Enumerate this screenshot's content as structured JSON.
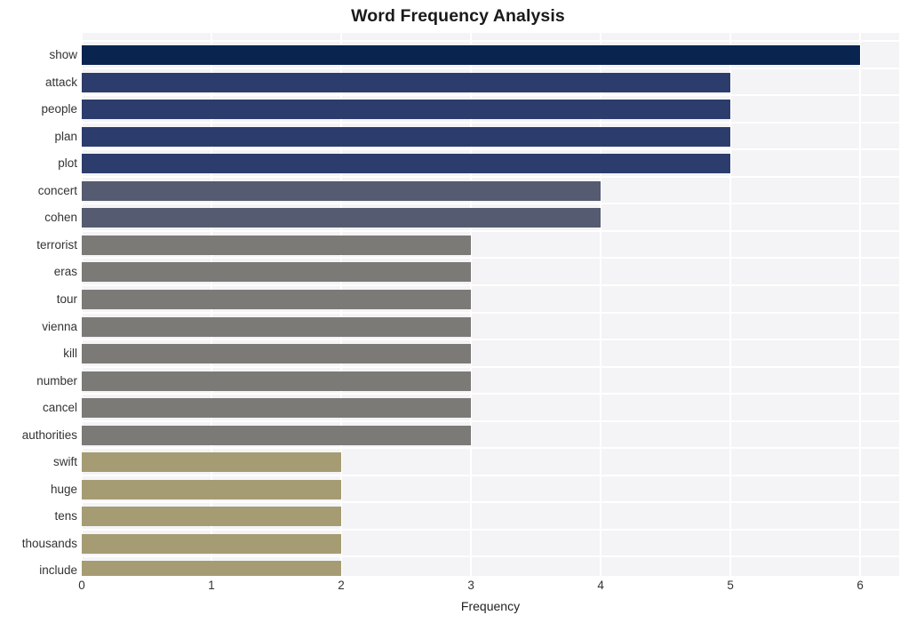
{
  "chart_data": {
    "type": "bar",
    "orientation": "horizontal",
    "title": "Word Frequency Analysis",
    "xlabel": "Frequency",
    "ylabel": "",
    "xlim": [
      0,
      6.3
    ],
    "xticks": [
      0,
      1,
      2,
      3,
      4,
      5,
      6
    ],
    "xtick_labels": [
      "0",
      "1",
      "2",
      "3",
      "4",
      "5",
      "6"
    ],
    "grid": true,
    "legend": false,
    "categories": [
      "show",
      "attack",
      "people",
      "plan",
      "plot",
      "concert",
      "cohen",
      "terrorist",
      "eras",
      "tour",
      "vienna",
      "kill",
      "number",
      "cancel",
      "authorities",
      "swift",
      "huge",
      "tens",
      "thousands",
      "include"
    ],
    "values": [
      6,
      5,
      5,
      5,
      5,
      4,
      4,
      3,
      3,
      3,
      3,
      3,
      3,
      3,
      3,
      2,
      2,
      2,
      2,
      2
    ],
    "bar_colors": [
      "#0a2450",
      "#2c3c6c",
      "#2c3c6c",
      "#2c3c6c",
      "#2c3c6c",
      "#555b70",
      "#555b70",
      "#7b7a77",
      "#7b7a77",
      "#7b7a77",
      "#7b7a77",
      "#7b7a77",
      "#7b7a77",
      "#7b7a77",
      "#7b7a77",
      "#a59c73",
      "#a59c73",
      "#a59c73",
      "#a59c73",
      "#a59c73"
    ],
    "bars": [
      {
        "label": "show",
        "value": 6,
        "color": "#0a2450"
      },
      {
        "label": "attack",
        "value": 5,
        "color": "#2c3c6c"
      },
      {
        "label": "people",
        "value": 5,
        "color": "#2c3c6c"
      },
      {
        "label": "plan",
        "value": 5,
        "color": "#2c3c6c"
      },
      {
        "label": "plot",
        "value": 5,
        "color": "#2c3c6c"
      },
      {
        "label": "concert",
        "value": 4,
        "color": "#555b70"
      },
      {
        "label": "cohen",
        "value": 4,
        "color": "#555b70"
      },
      {
        "label": "terrorist",
        "value": 3,
        "color": "#7b7a77"
      },
      {
        "label": "eras",
        "value": 3,
        "color": "#7b7a77"
      },
      {
        "label": "tour",
        "value": 3,
        "color": "#7b7a77"
      },
      {
        "label": "vienna",
        "value": 3,
        "color": "#7b7a77"
      },
      {
        "label": "kill",
        "value": 3,
        "color": "#7b7a77"
      },
      {
        "label": "number",
        "value": 3,
        "color": "#7b7a77"
      },
      {
        "label": "cancel",
        "value": 3,
        "color": "#7b7a77"
      },
      {
        "label": "authorities",
        "value": 3,
        "color": "#7b7a77"
      },
      {
        "label": "swift",
        "value": 2,
        "color": "#a59c73"
      },
      {
        "label": "huge",
        "value": 2,
        "color": "#a59c73"
      },
      {
        "label": "tens",
        "value": 2,
        "color": "#a59c73"
      },
      {
        "label": "thousands",
        "value": 2,
        "color": "#a59c73"
      },
      {
        "label": "include",
        "value": 2,
        "color": "#a59c73"
      }
    ],
    "style": {
      "plot_background": "#f4f4f6",
      "figure_background": "#ffffff",
      "gridline_color": "#ffffff",
      "tick_label_color": "#333333",
      "title_color": "#1a1a1a"
    }
  }
}
